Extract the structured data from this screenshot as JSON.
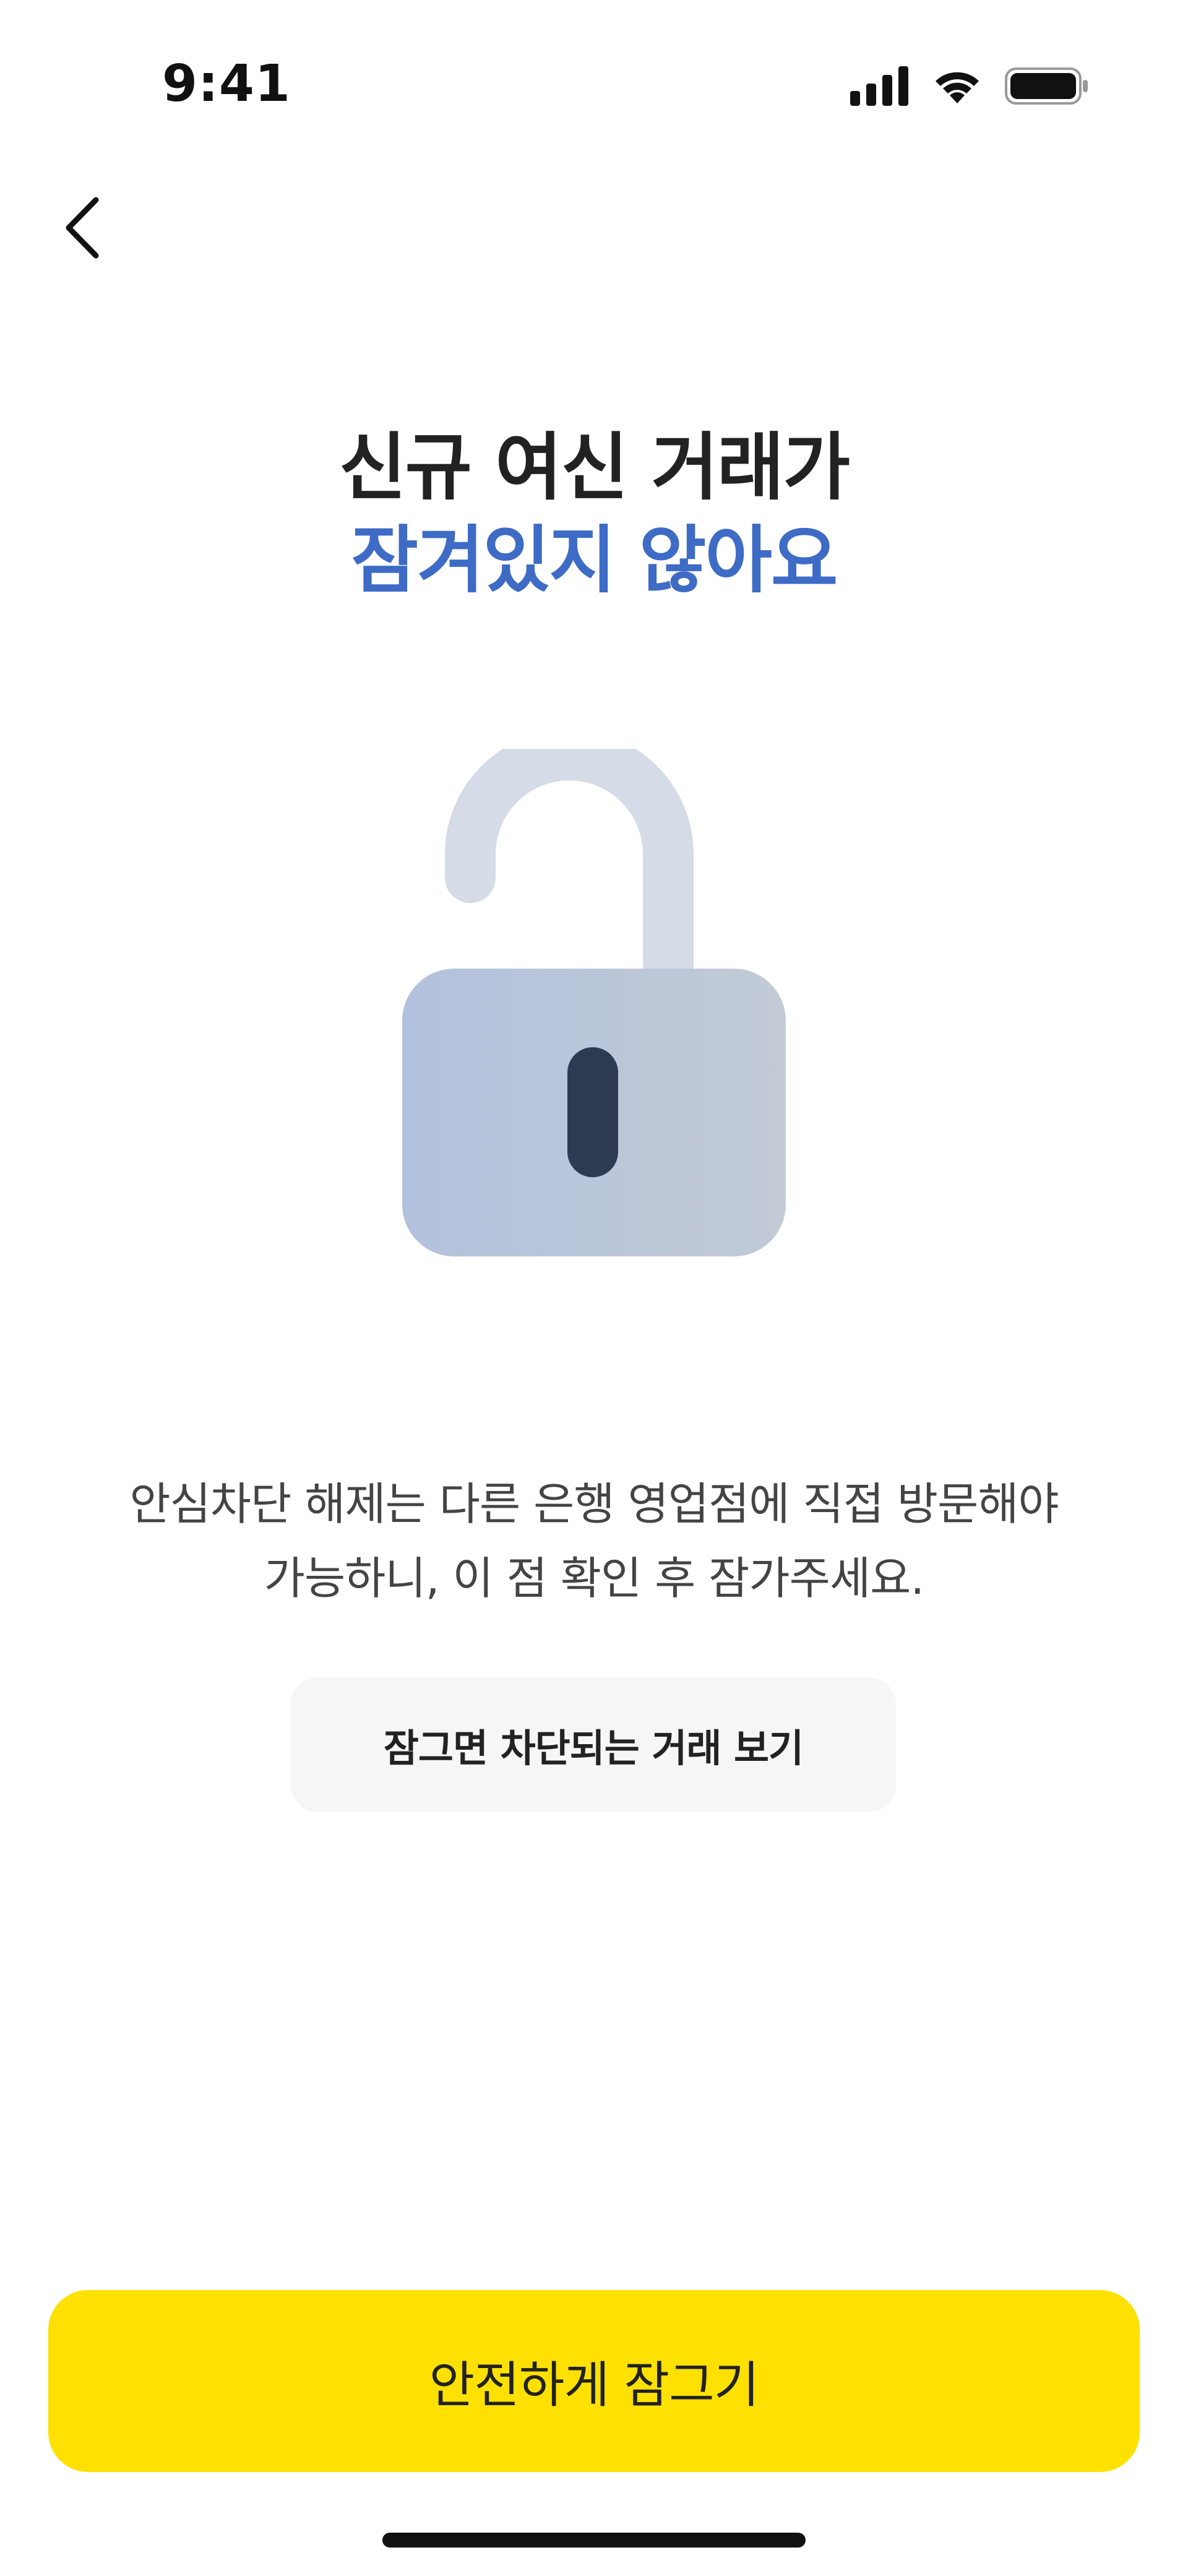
{
  "status_bar": {
    "time": "9:41",
    "icons": [
      "cellular-signal-icon",
      "wifi-icon",
      "battery-icon"
    ]
  },
  "nav": {
    "back_icon": "chevron-left-icon"
  },
  "title": {
    "line1": "신규 여신 거래가",
    "line2": "잠겨있지 않아요",
    "accent_color": "#3d6bc5"
  },
  "illustration": {
    "icon": "unlocked-padlock-icon"
  },
  "description": {
    "line1": "안심차단 해제는 다른 은행 영업점에 직접 방문해야",
    "line2": "가능하니, 이 점 확인 후 잠가주세요."
  },
  "secondary_button": {
    "label": "잠그면 차단되는 거래 보기"
  },
  "primary_button": {
    "label": "안전하게 잠그기",
    "color": "#fee100"
  }
}
